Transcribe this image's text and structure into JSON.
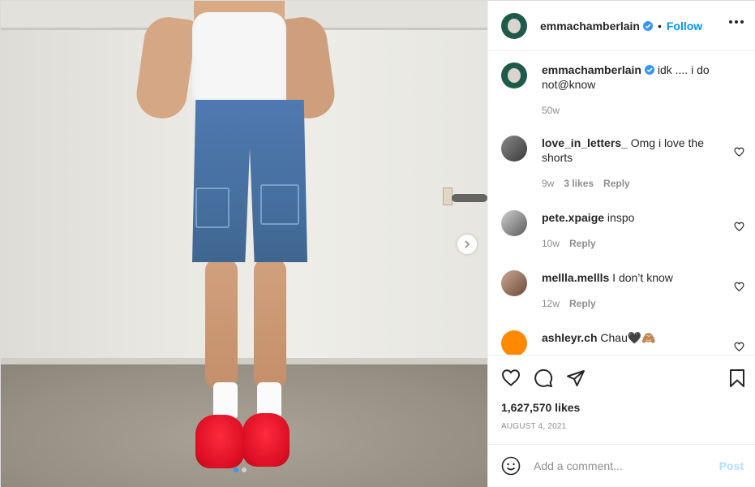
{
  "post": {
    "username": "emmachamberlain",
    "verified": true,
    "separator": "•",
    "follow_label": "Follow",
    "caption_user": "emmachamberlain",
    "caption_text": "idk .... i do not@know",
    "caption_time": "50w"
  },
  "comments": [
    {
      "user": "love_in_letters_",
      "text": "Omg i love the shorts",
      "time": "9w",
      "likes": "3 likes",
      "reply": "Reply"
    },
    {
      "user": "pete.xpaige",
      "text": "inspo",
      "time": "10w",
      "reply": "Reply"
    },
    {
      "user": "mellla.mellls",
      "text": "I don’t know",
      "time": "12w",
      "reply": "Reply"
    },
    {
      "user": "ashleyr.ch",
      "text": "Chau🖤🙈"
    }
  ],
  "actions": {
    "likes_count": "1,627,570 likes",
    "date": "AUGUST 4, 2021"
  },
  "add_comment": {
    "placeholder": "Add a comment...",
    "post_label": "Post"
  },
  "carousel": {
    "slide_count": 2,
    "active_index": 0
  },
  "colors": {
    "accent": "#0095f6",
    "post_disabled": "#b2dffc",
    "muted": "#8e8e8e",
    "slipper_red": "#dc0f24"
  },
  "icons": [
    "heart-icon",
    "comment-icon",
    "share-icon",
    "bookmark-icon",
    "emoji-icon",
    "more-icon",
    "chevron-right-icon",
    "verified-badge-icon"
  ]
}
